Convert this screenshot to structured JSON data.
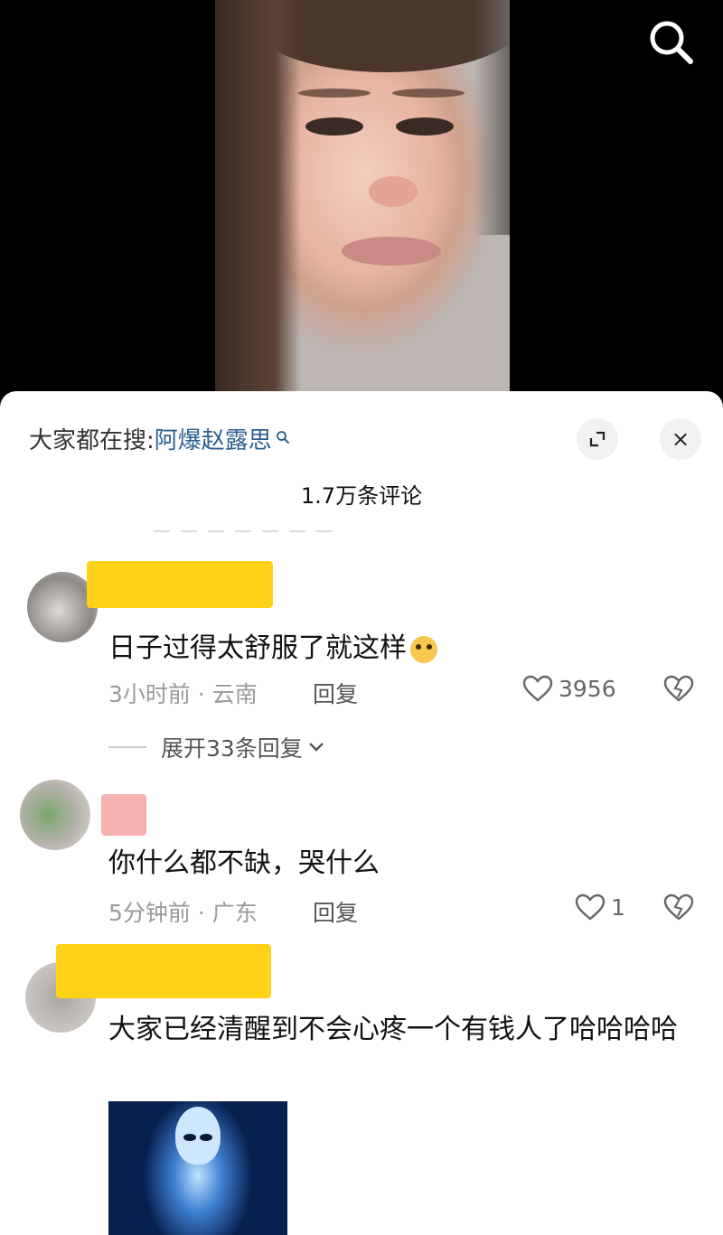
{
  "top": {
    "search_icon": "search-icon"
  },
  "header": {
    "trending_label": "大家都在搜:",
    "trending_query": "阿爆赵露思",
    "expand_icon": "expand-icon",
    "close_label": "×",
    "comment_count": "1.7万条评论"
  },
  "comments": [
    {
      "text": "日子过得太舒服了就这样",
      "emoji": "smiling-face-emoji",
      "meta": "3小时前 · 云南",
      "reply_label": "回复",
      "likes": "3956",
      "expand_replies": "展开33条回复"
    },
    {
      "text": "你什么都不缺，哭什么",
      "meta": "5分钟前 · 广东",
      "reply_label": "回复",
      "likes": "1"
    },
    {
      "text": "大家已经清醒到不会心疼一个有钱人了哈哈哈哈",
      "image": "alien-image"
    }
  ],
  "colors": {
    "link": "#2a5f8f",
    "censor": "#ffd21a",
    "meta": "#9a9a9a"
  }
}
